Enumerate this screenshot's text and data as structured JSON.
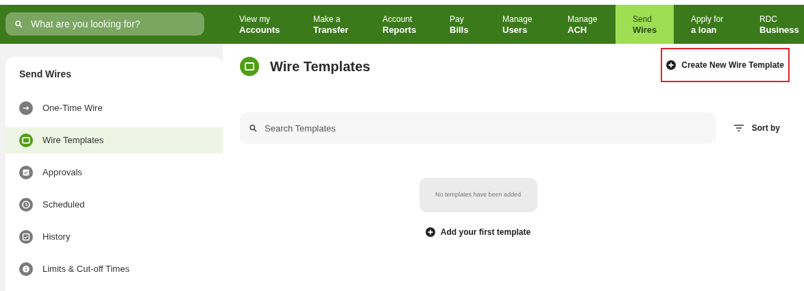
{
  "search": {
    "placeholder": "What are you looking for?"
  },
  "nav": [
    {
      "line1": "View my",
      "line2": "Accounts",
      "selected": false
    },
    {
      "line1": "Make a",
      "line2": "Transfer",
      "selected": false
    },
    {
      "line1": "Account",
      "line2": "Reports",
      "selected": false
    },
    {
      "line1": "Pay",
      "line2": "Bills",
      "selected": false
    },
    {
      "line1": "Manage",
      "line2": "Users",
      "selected": false
    },
    {
      "line1": "Manage",
      "line2": "ACH",
      "selected": false
    },
    {
      "line1": "Send",
      "line2": "Wires",
      "selected": true
    },
    {
      "line1": "Apply for",
      "line2": "a loan",
      "selected": false
    },
    {
      "line1": "RDC",
      "line2": "Business",
      "selected": false
    }
  ],
  "sidebar": {
    "title": "Send Wires",
    "items": [
      {
        "label": "One-Time Wire",
        "kind": "arrow",
        "selected": false
      },
      {
        "label": "Wire Templates",
        "kind": "folder",
        "selected": true
      },
      {
        "label": "Approvals",
        "kind": "check",
        "selected": false
      },
      {
        "label": "Scheduled",
        "kind": "clock",
        "selected": false
      },
      {
        "label": "History",
        "kind": "calendar",
        "selected": false
      },
      {
        "label": "Limits & Cut-off Times",
        "kind": "info",
        "selected": false
      }
    ]
  },
  "main": {
    "title": "Wire Templates",
    "create_button": {
      "label": "Create New Wire Template",
      "highlighted": true
    },
    "search": {
      "placeholder": "Search Templates"
    },
    "sort_label": "Sort by",
    "empty_message": "No templates have been added",
    "add_link": "Add your first template"
  }
}
